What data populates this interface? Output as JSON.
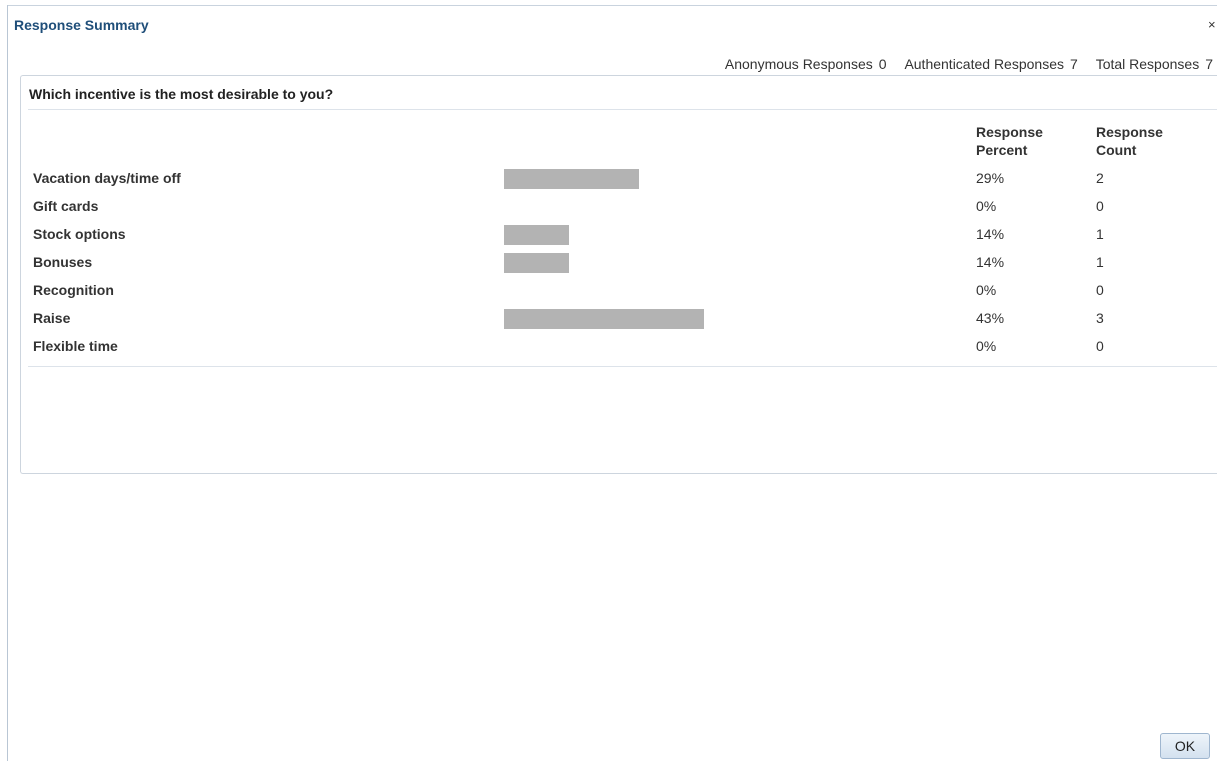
{
  "dialog": {
    "title": "Response Summary",
    "close_glyph": "×"
  },
  "stats": [
    {
      "label": "Anonymous Responses",
      "value": "0"
    },
    {
      "label": "Authenticated Responses",
      "value": "7"
    },
    {
      "label": "Total Responses",
      "value": "7"
    }
  ],
  "question": "Which incentive is the most desirable to you?",
  "columns": {
    "percent_header": "Response Percent",
    "count_header": "Response Count"
  },
  "bar_color": "#b3b3b3",
  "chart_data": {
    "type": "bar",
    "orientation": "horizontal",
    "categories": [
      "Vacation days/time off",
      "Gift cards",
      "Stock options",
      "Bonuses",
      "Recognition",
      "Raise",
      "Flexible time"
    ],
    "values": [
      29,
      0,
      14,
      14,
      0,
      43,
      0
    ],
    "percent_labels": [
      "29%",
      "0%",
      "14%",
      "14%",
      "0%",
      "43%",
      "0%"
    ],
    "counts": [
      "2",
      "0",
      "1",
      "1",
      "0",
      "3",
      "0"
    ],
    "xlim": [
      0,
      100
    ]
  },
  "footer": {
    "ok_label": "OK"
  }
}
